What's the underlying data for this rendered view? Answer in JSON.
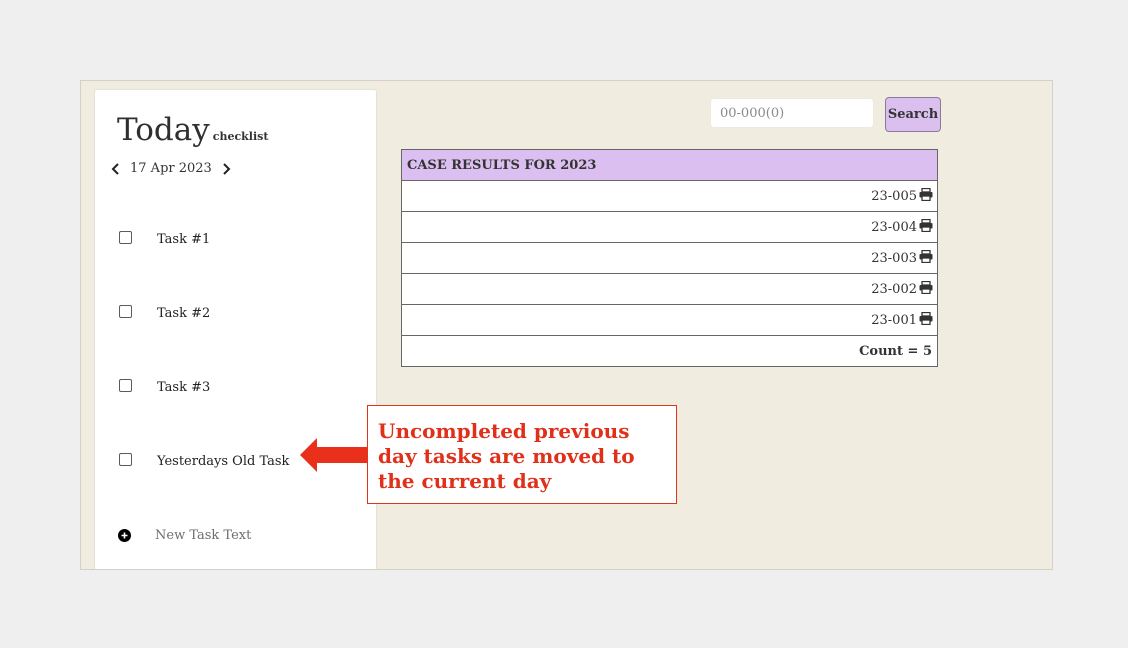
{
  "checklist": {
    "title": "Today",
    "subtitle": "checklist",
    "date": "17 Apr 2023",
    "tasks": [
      {
        "label": "Task #1",
        "checked": false
      },
      {
        "label": "Task #2",
        "checked": false
      },
      {
        "label": "Task #3",
        "checked": false
      },
      {
        "label": "Yesterdays Old Task",
        "checked": false
      }
    ],
    "new_task_placeholder": "New Task Text"
  },
  "search": {
    "placeholder": "00-000(0)",
    "button_label": "Search"
  },
  "results": {
    "header": "CASE RESULTS FOR 2023",
    "rows": [
      "23-005",
      "23-004",
      "23-003",
      "23-002",
      "23-001"
    ],
    "count_label": "Count = 5"
  },
  "annotation": {
    "text": "Uncompleted previous day tasks are moved to the current day",
    "color": "#e0301a"
  },
  "colors": {
    "background": "#f0ede0",
    "table_header": "#dbbff0",
    "search_button": "#dbc0ef"
  }
}
